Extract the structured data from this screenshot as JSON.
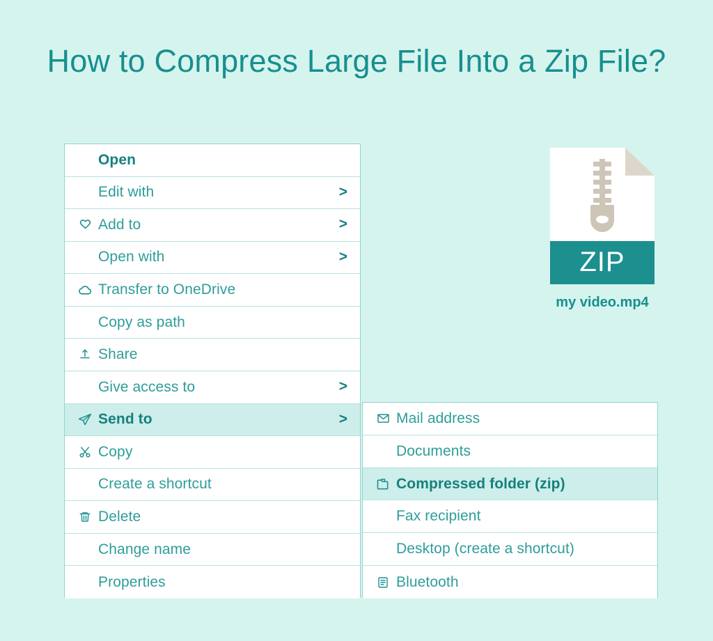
{
  "page": {
    "title": "How to Compress Large File Into a Zip File?",
    "background_color": "#d6f4ee",
    "accent_color": "#178f8f",
    "highlight_color": "#cdeeea"
  },
  "context_menu": {
    "name": "file-context-menu",
    "items": [
      {
        "label": "Open",
        "icon": "none",
        "arrow": "",
        "bold": true,
        "highlighted": false
      },
      {
        "label": "Edit with",
        "icon": "none",
        "arrow": ">",
        "bold": false,
        "highlighted": false
      },
      {
        "label": "Add to",
        "icon": "heart-icon",
        "arrow": ">",
        "bold": false,
        "highlighted": false
      },
      {
        "label": "Open with",
        "icon": "none",
        "arrow": ">",
        "bold": false,
        "highlighted": false
      },
      {
        "label": "Transfer to OneDrive",
        "icon": "cloud-icon",
        "arrow": "",
        "bold": false,
        "highlighted": false
      },
      {
        "label": "Copy as path",
        "icon": "none",
        "arrow": "",
        "bold": false,
        "highlighted": false
      },
      {
        "label": "Share",
        "icon": "share-icon",
        "arrow": "",
        "bold": false,
        "highlighted": false
      },
      {
        "label": "Give access to",
        "icon": "none",
        "arrow": ">",
        "bold": false,
        "highlighted": false
      },
      {
        "label": "Send to",
        "icon": "send-icon",
        "arrow": ">",
        "bold": true,
        "highlighted": true
      },
      {
        "label": "Copy",
        "icon": "scissors-icon",
        "arrow": "",
        "bold": false,
        "highlighted": false
      },
      {
        "label": "Create a shortcut",
        "icon": "none",
        "arrow": "",
        "bold": false,
        "highlighted": false
      },
      {
        "label": "Delete",
        "icon": "trash-icon",
        "arrow": "",
        "bold": false,
        "highlighted": false
      },
      {
        "label": "Change name",
        "icon": "none",
        "arrow": "",
        "bold": false,
        "highlighted": false
      },
      {
        "label": "Properties",
        "icon": "none",
        "arrow": "",
        "bold": false,
        "highlighted": false
      }
    ]
  },
  "send_to_submenu": {
    "name": "send-to-submenu",
    "items": [
      {
        "label": "Mail address",
        "icon": "envelope-icon",
        "bold": false,
        "highlighted": false
      },
      {
        "label": "Documents",
        "icon": "none",
        "bold": false,
        "highlighted": false
      },
      {
        "label": "Compressed folder (zip)",
        "icon": "folder-icon",
        "bold": true,
        "highlighted": true
      },
      {
        "label": "Fax recipient",
        "icon": "none",
        "bold": false,
        "highlighted": false
      },
      {
        "label": "Desktop (create a shortcut)",
        "icon": "none",
        "bold": false,
        "highlighted": false
      },
      {
        "label": "Bluetooth",
        "icon": "document-icon",
        "bold": false,
        "highlighted": false
      }
    ]
  },
  "zip_file": {
    "badge_label": "ZIP",
    "file_name": "my video.mp4",
    "page_color": "#ffffff",
    "fold_color": "#ddd7cb",
    "band_color": "#1c8f8f",
    "zipper_color": "#cdc5b8"
  }
}
